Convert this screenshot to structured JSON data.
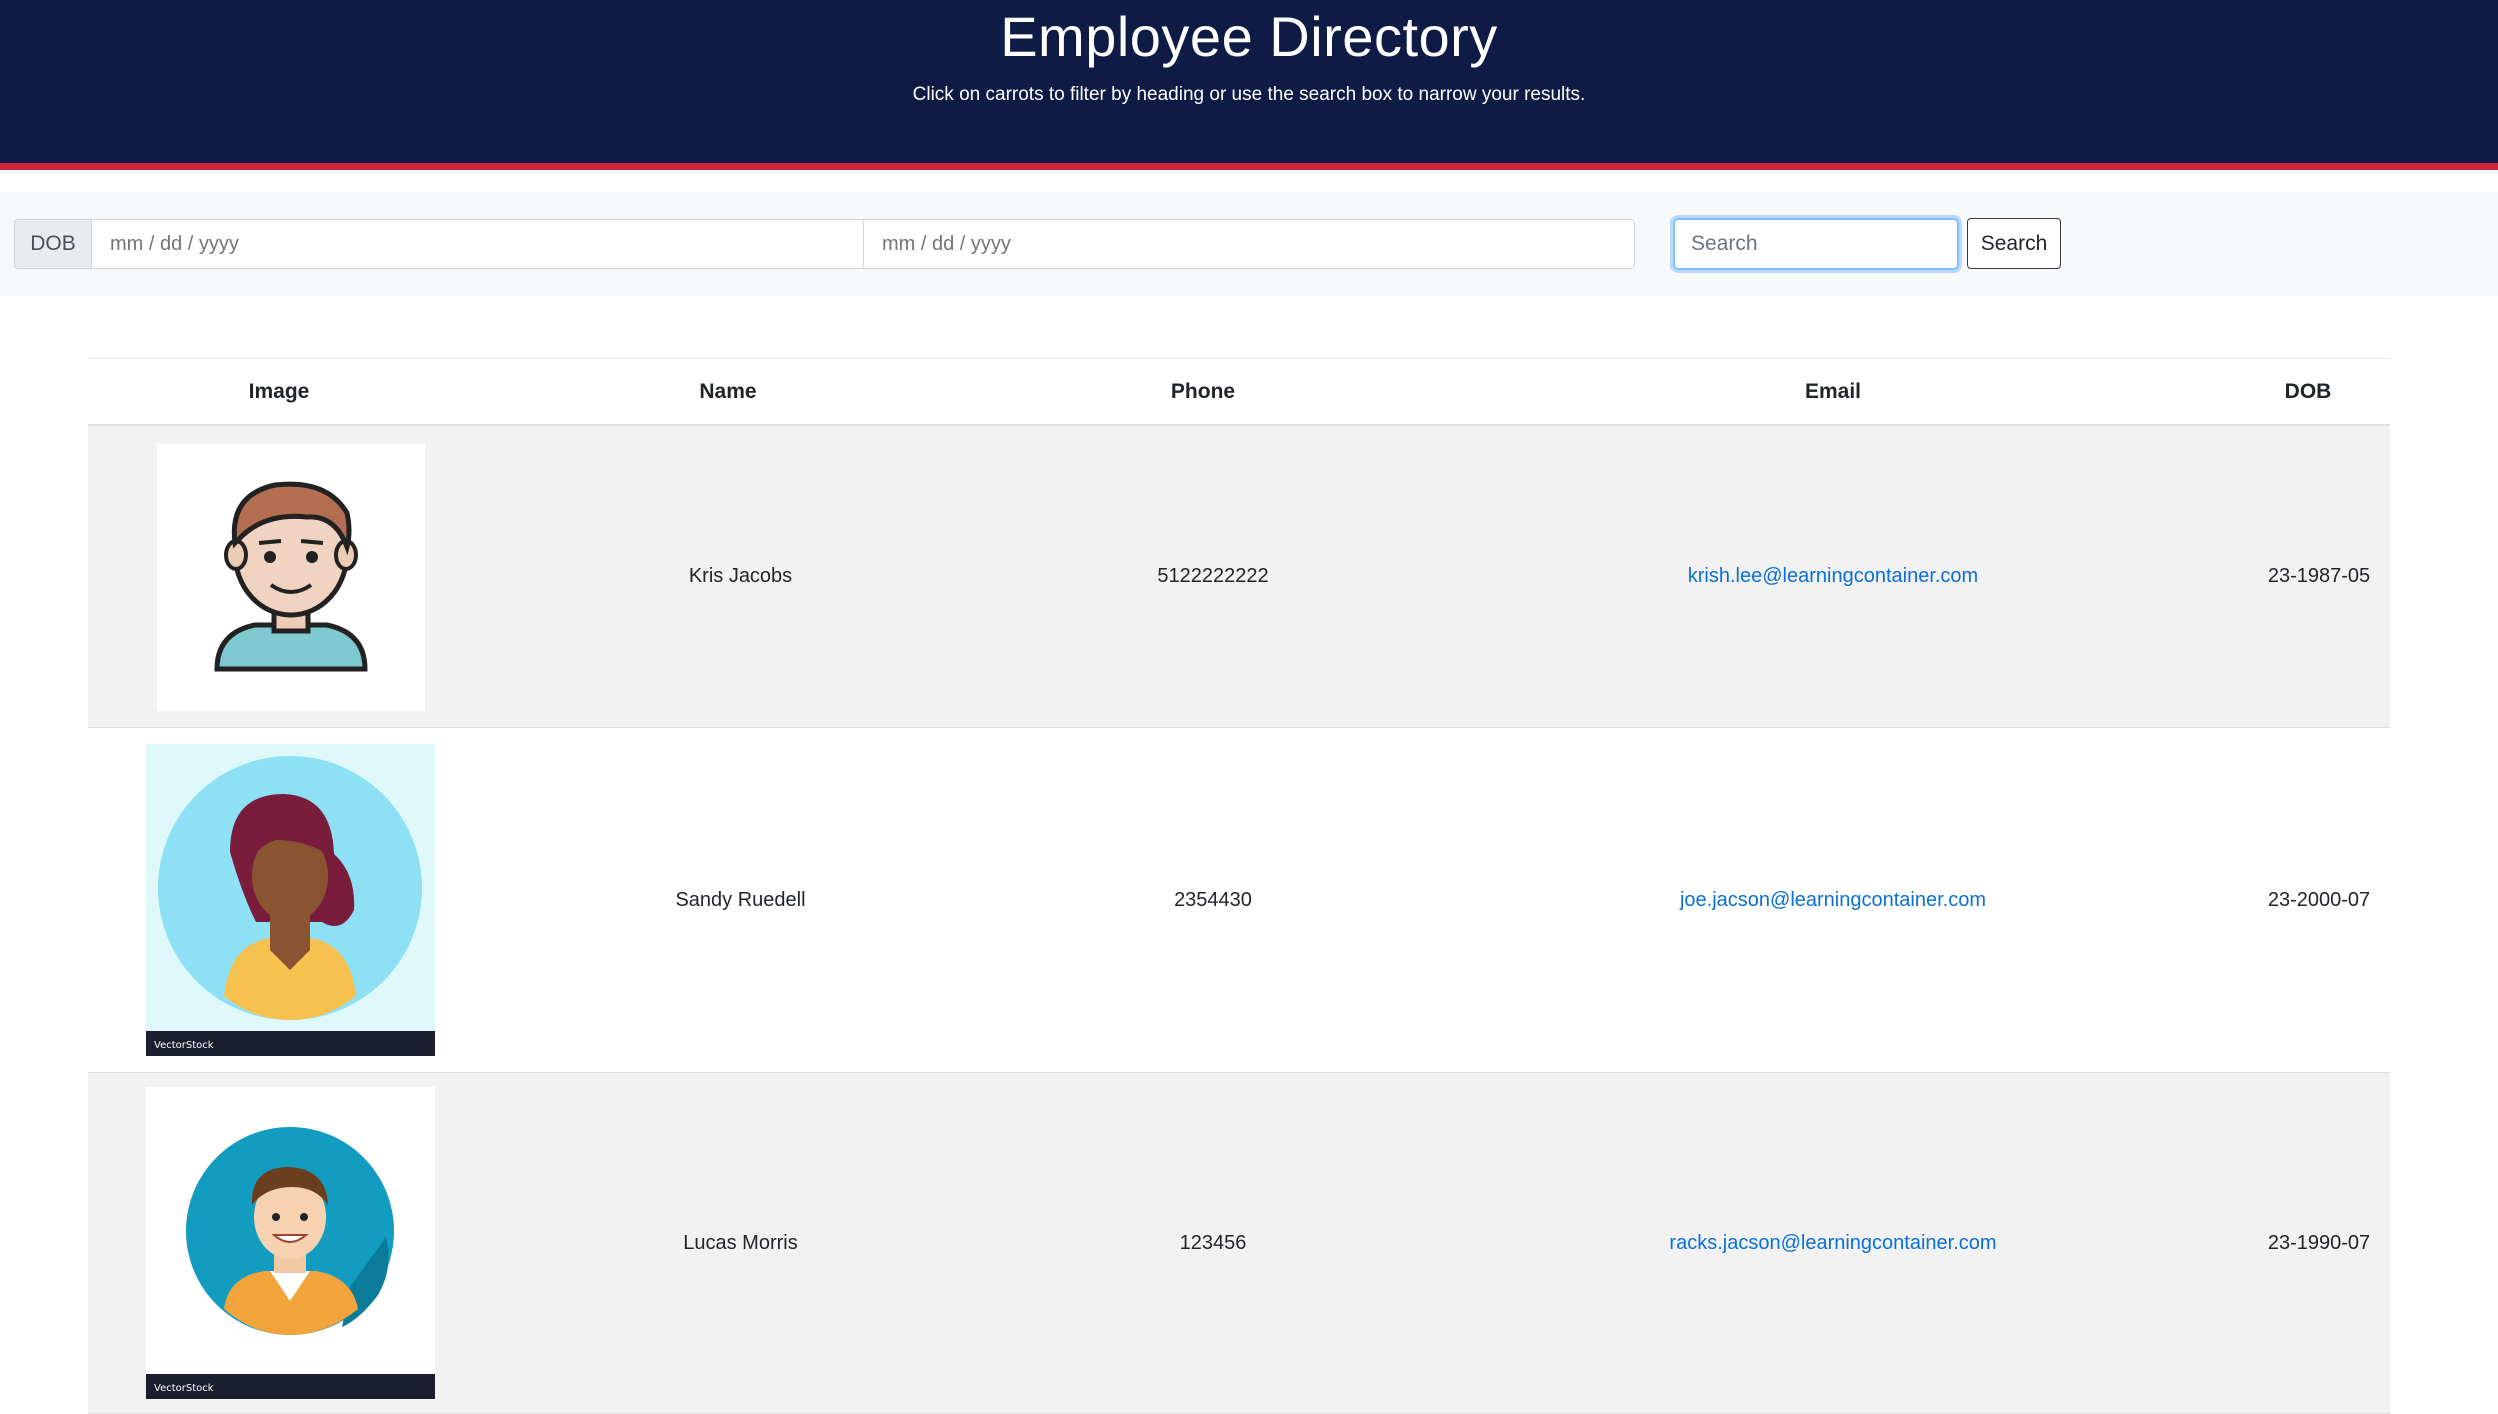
{
  "header": {
    "title": "Employee Directory",
    "subtitle": "Click on carrots to filter by heading or use the search box to narrow your results."
  },
  "filters": {
    "dob_label": "DOB",
    "date_from_placeholder": "mm / dd / yyyy",
    "date_to_placeholder": "mm / dd / yyyy",
    "search_placeholder": "Search",
    "search_button_label": "Search"
  },
  "table": {
    "columns": [
      "Image",
      "Name",
      "Phone",
      "Email",
      "DOB"
    ],
    "rows": [
      {
        "image": "avatar-man-icon",
        "name": "Kris Jacobs",
        "phone": "5122222222",
        "email": "krish.lee@learningcontainer.com",
        "dob": "23-1987-05"
      },
      {
        "image": "avatar-woman-icon",
        "name": "Sandy Ruedell",
        "phone": "2354430",
        "email": "joe.jacson@learningcontainer.com",
        "dob": "23-2000-07"
      },
      {
        "image": "avatar-man-circle-icon",
        "name": "Lucas Morris",
        "phone": "123456",
        "email": "racks.jacson@learningcontainer.com",
        "dob": "23-1990-07"
      }
    ]
  },
  "watermark": {
    "brand": "VectorStock"
  },
  "colors": {
    "header_bg": "#0e1c45",
    "header_accent": "#d0243a",
    "link": "#0a6fd8",
    "row_stripe": "#f2f2f2"
  }
}
